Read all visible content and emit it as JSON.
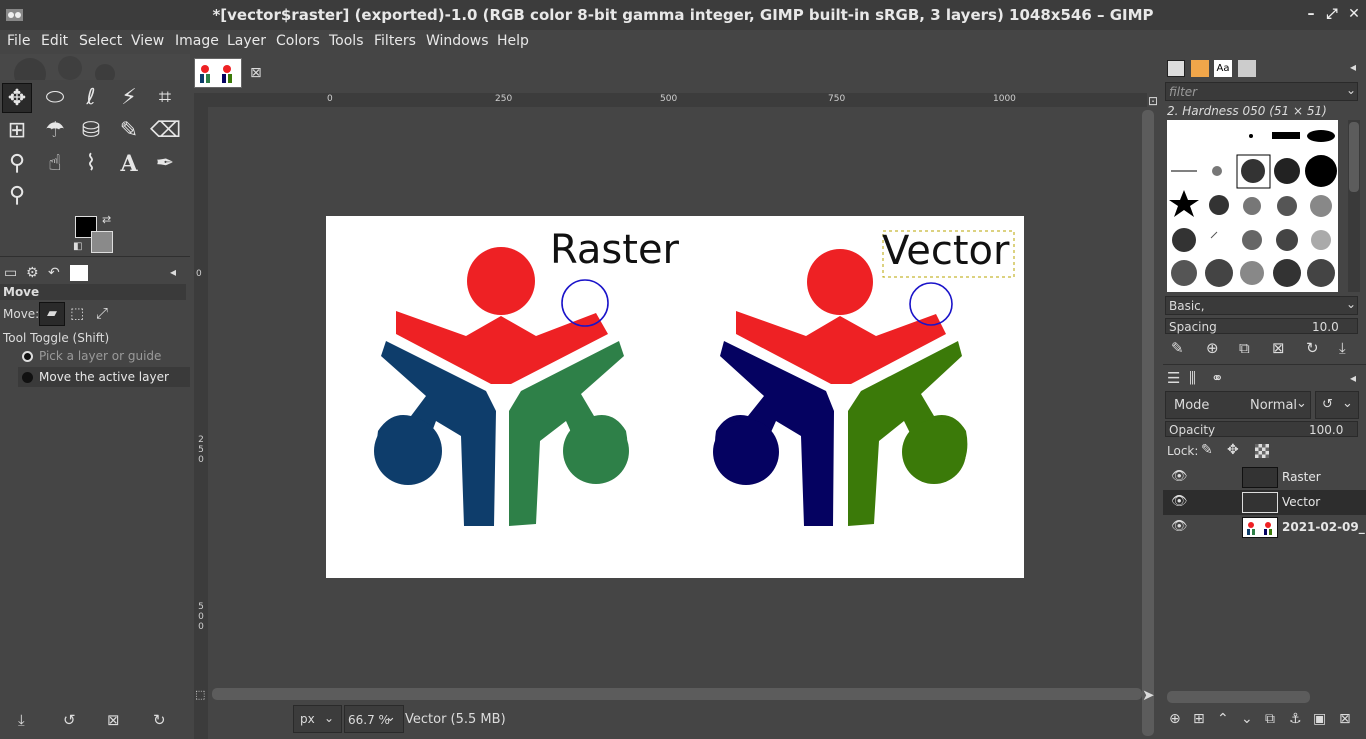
{
  "window": {
    "title": "*[vector$raster] (exported)-1.0 (RGB color 8-bit gamma integer, GIMP built-in sRGB, 3 layers) 1048x546 – GIMP"
  },
  "menu": [
    "File",
    "Edit",
    "Select",
    "View",
    "Image",
    "Layer",
    "Colors",
    "Tools",
    "Filters",
    "Windows",
    "Help"
  ],
  "tool_options": {
    "title": "Move",
    "move_label": "Move:",
    "toggle_label": "Tool Toggle  (Shift)",
    "option1": "Pick a layer or guide",
    "option2": "Move the active layer"
  },
  "rulers": {
    "top": [
      "0",
      "250",
      "500",
      "750",
      "1000"
    ],
    "left": [
      "0",
      "250",
      "500"
    ]
  },
  "image": {
    "raster_text": "Raster",
    "vector_text": "Vector"
  },
  "status": {
    "unit": "px",
    "zoom": "66.7 %",
    "info": "Vector (5.5 MB)"
  },
  "brushes": {
    "filter_placeholder": "filter",
    "selected": "2. Hardness 050 (51 × 51)",
    "tag": "Basic,",
    "spacing_label": "Spacing",
    "spacing_value": "10.0"
  },
  "layers": {
    "mode_label": "Mode",
    "mode_value": "Normal",
    "opacity_label": "Opacity",
    "opacity_value": "100.0",
    "lock_label": "Lock:",
    "items": [
      {
        "name": "Raster"
      },
      {
        "name": "Vector"
      },
      {
        "name": "2021-02-09_"
      }
    ]
  },
  "colors": {
    "red": "#ee2124",
    "blue_raster": "#0e3d6b",
    "green_raster": "#2e8048",
    "blue_vector": "#050261",
    "green_vector": "#3b7a09",
    "circle": "#1a13c9"
  }
}
